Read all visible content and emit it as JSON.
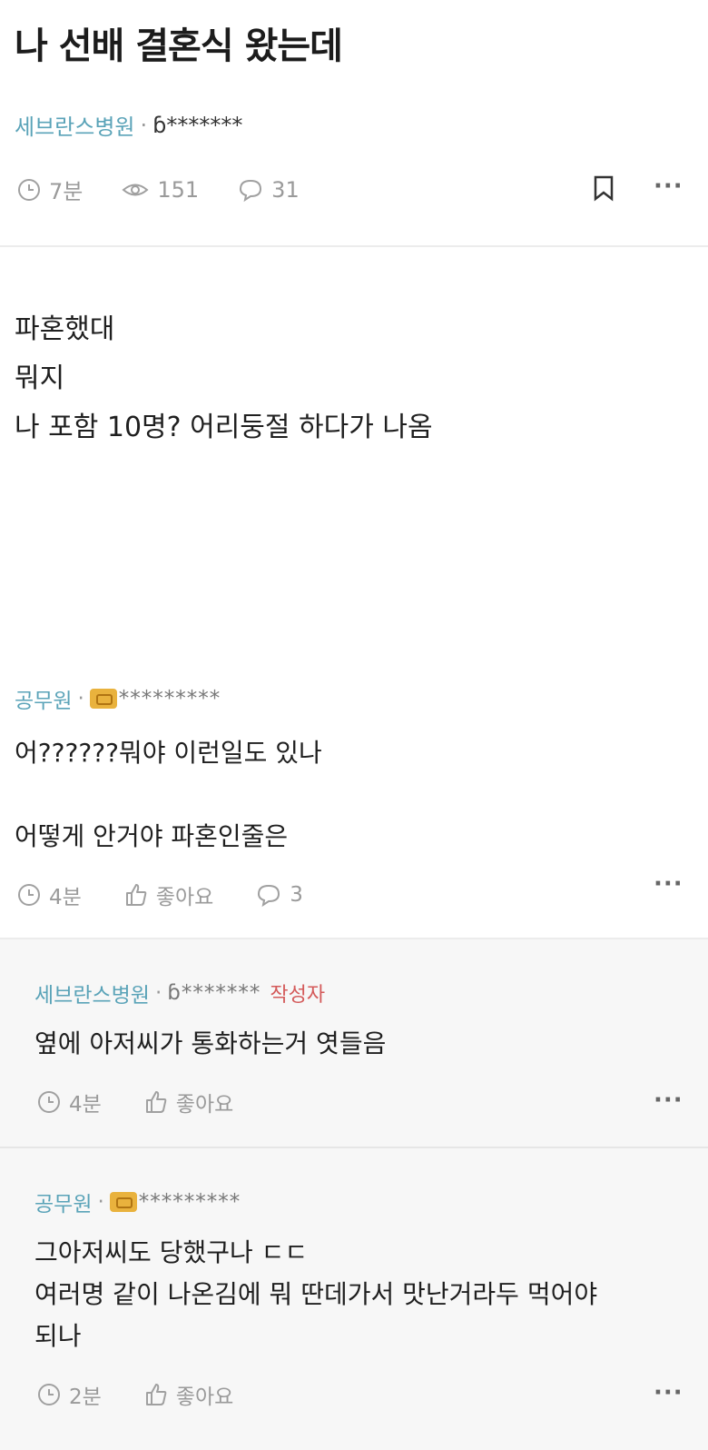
{
  "post": {
    "title": "나 선배 결혼식 왔는데",
    "company": "세브란스병원",
    "separator": "·",
    "nickname": "ɓ*******",
    "time": "7분",
    "views": "151",
    "comments": "31",
    "more": "···",
    "body": [
      "파혼했대",
      "뭐지",
      "나 포함 10명? 어리둥절 하다가 나옴"
    ]
  },
  "comments": [
    {
      "company": "공무원",
      "separator": "·",
      "badge_icon": "fist-badge-icon",
      "nickname": "*********",
      "lines": [
        "어??????뭐야 이런일도 있나",
        "",
        "어떻게 안거야 파혼인줄은"
      ],
      "time": "4분",
      "like": "좋아요",
      "reply_count": "3",
      "more": "···"
    },
    {
      "company": "세브란스병원",
      "separator": "·",
      "nickname": "ɓ*******",
      "writer_tag": "작성자",
      "lines": [
        "옆에 아저씨가 통화하는거 엿들음"
      ],
      "time": "4분",
      "like": "좋아요",
      "more": "···"
    },
    {
      "company": "공무원",
      "separator": "·",
      "badge_icon": "fist-badge-icon",
      "nickname": "*********",
      "lines": [
        "그아저씨도 당했구나 ㄷㄷ",
        "여러명 같이 나온김에 뭐 딴데가서 맛난거라두 먹어야",
        "되나"
      ],
      "time": "2분",
      "like": "좋아요",
      "more": "···"
    }
  ]
}
